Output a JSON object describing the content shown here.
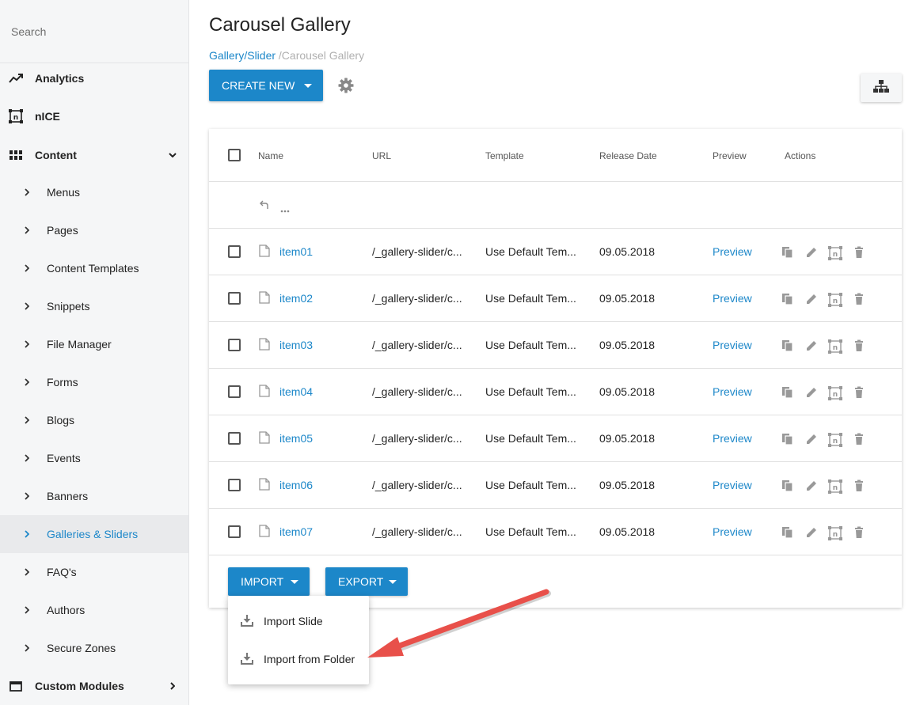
{
  "sidebar": {
    "search_placeholder": "Search",
    "items": [
      {
        "label": "Analytics",
        "icon": "trending-up-icon"
      },
      {
        "label": "nICE",
        "icon": "nice-icon"
      },
      {
        "label": "Content",
        "icon": "grid-icon"
      },
      {
        "label": "Menus"
      },
      {
        "label": "Pages"
      },
      {
        "label": "Content Templates"
      },
      {
        "label": "Snippets"
      },
      {
        "label": "File Manager"
      },
      {
        "label": "Forms"
      },
      {
        "label": "Blogs"
      },
      {
        "label": "Events"
      },
      {
        "label": "Banners"
      },
      {
        "label": "Galleries & Sliders",
        "active": true
      },
      {
        "label": "FAQ's"
      },
      {
        "label": "Authors"
      },
      {
        "label": "Secure Zones"
      },
      {
        "label": "Custom Modules",
        "icon": "window-icon"
      }
    ]
  },
  "header": {
    "title": "Carousel Gallery",
    "breadcrumb_parent": "Gallery/Slider",
    "breadcrumb_current": "/Carousel Gallery",
    "create_label": "CREATE NEW"
  },
  "table": {
    "columns": [
      "Name",
      "URL",
      "Template",
      "Release Date",
      "Preview",
      "Actions"
    ],
    "rows": [
      {
        "name": "item01",
        "url": "/_gallery-slider/c...",
        "template": "Use Default Tem...",
        "date": "09.05.2018",
        "preview": "Preview"
      },
      {
        "name": "item02",
        "url": "/_gallery-slider/c...",
        "template": "Use Default Tem...",
        "date": "09.05.2018",
        "preview": "Preview"
      },
      {
        "name": "item03",
        "url": "/_gallery-slider/c...",
        "template": "Use Default Tem...",
        "date": "09.05.2018",
        "preview": "Preview"
      },
      {
        "name": "item04",
        "url": "/_gallery-slider/c...",
        "template": "Use Default Tem...",
        "date": "09.05.2018",
        "preview": "Preview"
      },
      {
        "name": "item05",
        "url": "/_gallery-slider/c...",
        "template": "Use Default Tem...",
        "date": "09.05.2018",
        "preview": "Preview"
      },
      {
        "name": "item06",
        "url": "/_gallery-slider/c...",
        "template": "Use Default Tem...",
        "date": "09.05.2018",
        "preview": "Preview"
      },
      {
        "name": "item07",
        "url": "/_gallery-slider/c...",
        "template": "Use Default Tem...",
        "date": "09.05.2018",
        "preview": "Preview"
      }
    ]
  },
  "footer": {
    "import_label": "IMPORT",
    "export_label": "EXPORT"
  },
  "import_menu": {
    "items": [
      "Import Slide",
      "Import from Folder"
    ]
  },
  "colors": {
    "accent": "#1c87c9",
    "annotation_arrow": "#e8504a"
  }
}
